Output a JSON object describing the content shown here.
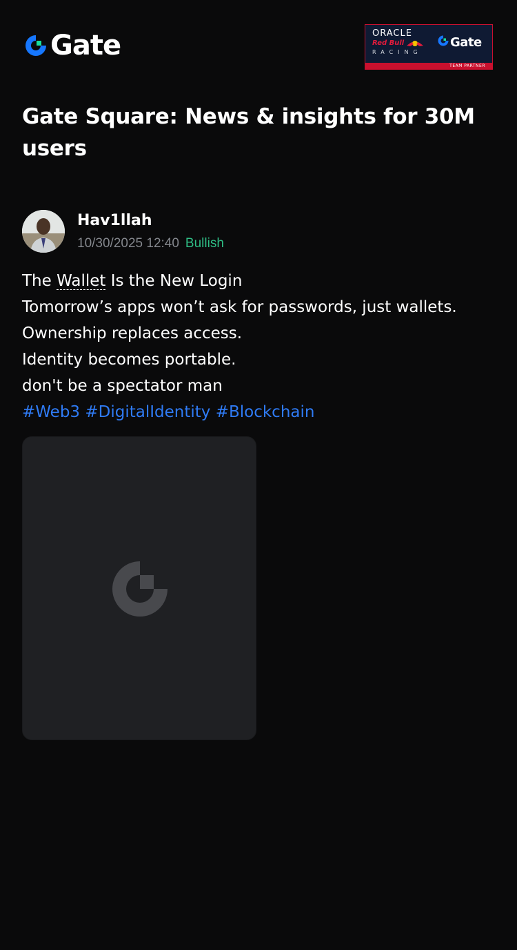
{
  "header": {
    "brand_name": "Gate",
    "brand_colors": {
      "ring": "#1677ff",
      "accent": "#17e0a0"
    },
    "partner_badge": {
      "oracle": "ORACLE",
      "redbull": "Red Bull",
      "racing": "RACING",
      "gate": "Gate",
      "strip": "TEAM PARTNER",
      "colors": {
        "background": "#0f1a33",
        "strip": "#c8102e"
      }
    }
  },
  "page": {
    "title": "Gate Square: News & insights for 30M users"
  },
  "post": {
    "author": {
      "name": "Hav1llah",
      "avatar_icon": "user-photo"
    },
    "timestamp": "10/30/2025 12:40",
    "sentiment": "Bullish",
    "sentiment_color": "#2fbd85",
    "body": {
      "line1_prefix": "The ",
      "line1_keyword": "Wallet",
      "line1_suffix": " Is the New Login",
      "line2": "Tomorrow’s apps won’t ask for passwords, just wallets.",
      "line3": "Ownership replaces access.",
      "line4": "Identity becomes portable.",
      "line5": "don't be a spectator man"
    },
    "hashtags": [
      "#Web3",
      "#DigitalIdentity",
      "#Blockchain"
    ],
    "hashtag_color": "#2f7bf5",
    "media": {
      "placeholder_icon": "gate-logo-icon"
    }
  }
}
